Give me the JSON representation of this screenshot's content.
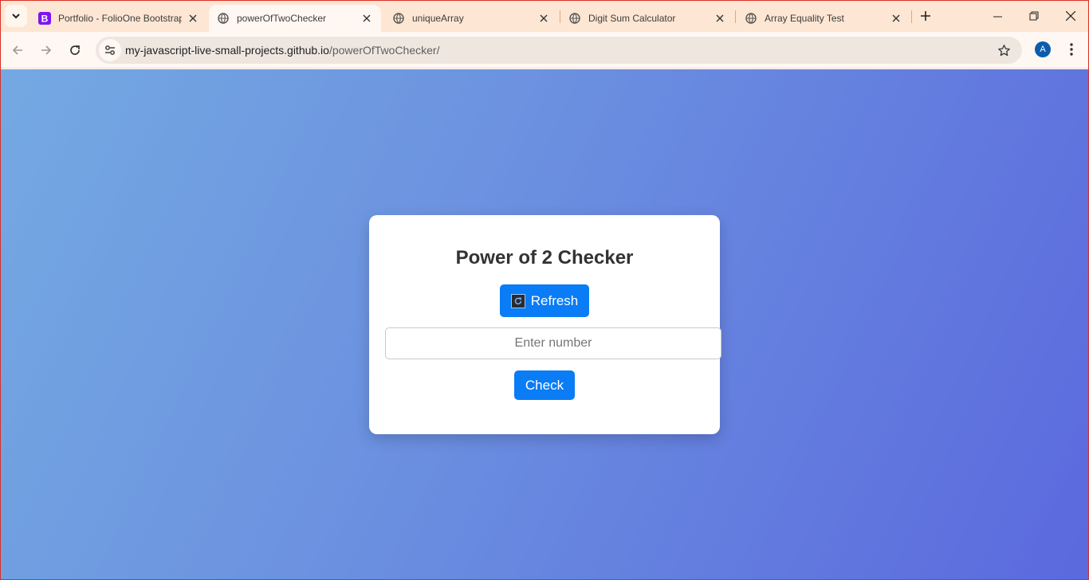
{
  "browser": {
    "tabs": [
      {
        "title": "Portfolio - FolioOne Bootstrap",
        "icon": "bootstrap-icon",
        "active": false
      },
      {
        "title": "powerOfTwoChecker",
        "icon": "globe-icon",
        "active": true
      },
      {
        "title": "uniqueArray",
        "icon": "globe-icon",
        "active": false
      },
      {
        "title": "Digit Sum Calculator",
        "icon": "globe-icon",
        "active": false
      },
      {
        "title": "Array Equality Test",
        "icon": "globe-icon",
        "active": false
      }
    ],
    "url_host": "my-javascript-live-small-projects.github.io",
    "url_path": "/powerOfTwoChecker/",
    "avatar_letter": "A"
  },
  "page": {
    "title": "Power of 2 Checker",
    "refresh_label": "Refresh",
    "input_placeholder": "Enter number",
    "input_value": "",
    "check_label": "Check"
  },
  "colors": {
    "accent": "#0a7cf5",
    "gradient_start": "#74a9e2",
    "gradient_end": "#5b69de",
    "tabstrip": "#fde6d3"
  }
}
